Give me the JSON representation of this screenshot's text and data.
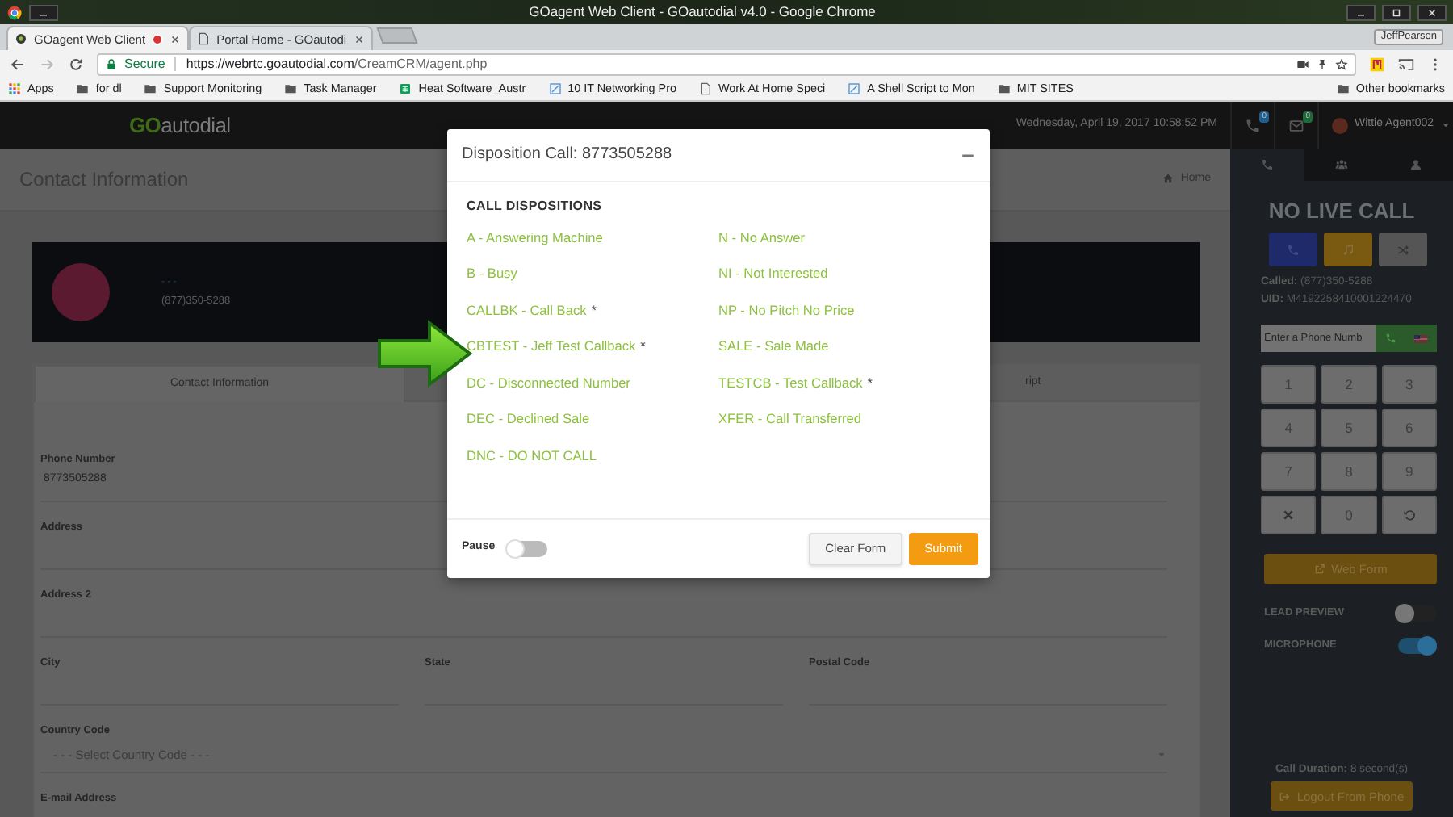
{
  "window": {
    "title": "GOagent Web Client - GOautodial v4.0 - Google Chrome"
  },
  "browser": {
    "tabs": [
      {
        "label": "GOagent Web Client",
        "selected": true,
        "recording": true
      },
      {
        "label": "Portal Home - GOautodi",
        "selected": false,
        "recording": false
      }
    ],
    "profile": "JeffPearson",
    "address": {
      "secure": "Secure",
      "host": "https://webrtc.goautodial.com",
      "path": "/CreamCRM/agent.php"
    },
    "bookmarks": [
      {
        "kind": "apps",
        "label": "Apps"
      },
      {
        "kind": "folder",
        "label": "for dl"
      },
      {
        "kind": "folder",
        "label": "Support Monitoring"
      },
      {
        "kind": "folder",
        "label": "Task Manager"
      },
      {
        "kind": "sheet",
        "label": "Heat Software_Austr"
      },
      {
        "kind": "link",
        "label": "10 IT Networking Pro"
      },
      {
        "kind": "page",
        "label": "Work At Home Speci"
      },
      {
        "kind": "link",
        "label": "A Shell Script to Mon"
      },
      {
        "kind": "folder",
        "label": "MIT SITES"
      }
    ],
    "other_bookmarks": "Other bookmarks"
  },
  "app": {
    "logo": {
      "prefix": "GO",
      "rest": "autodial"
    },
    "datetime": "Wednesday, April 19, 2017 10:58:52 PM",
    "notifications": [
      {
        "kind": "phone",
        "count": "0",
        "color": "#1f5f8f"
      },
      {
        "kind": "mail",
        "count": "0",
        "color": "#1d6b3a"
      }
    ],
    "user": "Wittie Agent002"
  },
  "page": {
    "title": "Contact Information",
    "breadcrumb": "Home",
    "contact": {
      "name": "- - -",
      "phone": "(877)350-5288"
    },
    "tabs": [
      {
        "label": "Contact Information",
        "selected": true
      },
      {
        "label": "ript",
        "selected": false
      }
    ],
    "field_rows": [
      {
        "fields": [
          {
            "kind": "text",
            "label": "Phone Number",
            "value": "8773505288"
          }
        ]
      },
      {
        "fields": [
          {
            "kind": "text",
            "label": "Address"
          }
        ]
      },
      {
        "fields": [
          {
            "kind": "text",
            "label": "Address 2"
          }
        ]
      },
      {
        "fields": [
          {
            "kind": "text",
            "label": "City"
          },
          {
            "kind": "text",
            "label": "State"
          },
          {
            "kind": "text",
            "label": "Postal Code"
          }
        ]
      },
      {
        "fields": [
          {
            "kind": "select",
            "label": "Country Code",
            "value": "- - - Select Country Code - - -"
          }
        ]
      },
      {
        "fields": [
          {
            "kind": "text",
            "label": "E-mail Address"
          }
        ]
      }
    ]
  },
  "sidebar": {
    "tabs": [
      {
        "kind": "phone",
        "selected": true
      },
      {
        "kind": "users",
        "selected": false
      },
      {
        "kind": "user",
        "selected": false
      }
    ],
    "status": "NO LIVE CALL",
    "call_buttons": [
      {
        "kind": "phone"
      },
      {
        "kind": "music"
      },
      {
        "kind": "shuffle"
      }
    ],
    "info": [
      {
        "label": "Called:",
        "value": "(877)350-5288"
      },
      {
        "label": "UID:",
        "value": "M4192258410001224470"
      }
    ],
    "dial": {
      "placeholder": "Enter a Phone Numb"
    },
    "keys": [
      {
        "kind": "digit",
        "label": "1"
      },
      {
        "kind": "digit",
        "label": "2"
      },
      {
        "kind": "digit",
        "label": "3"
      },
      {
        "kind": "digit",
        "label": "4"
      },
      {
        "kind": "digit",
        "label": "5"
      },
      {
        "kind": "digit",
        "label": "6"
      },
      {
        "kind": "digit",
        "label": "7"
      },
      {
        "kind": "digit",
        "label": "8"
      },
      {
        "kind": "digit",
        "label": "9"
      },
      {
        "kind": "clear"
      },
      {
        "kind": "digit",
        "label": "0"
      },
      {
        "kind": "undo"
      }
    ],
    "web_form": "Web Form",
    "toggles": [
      {
        "label": "LEAD PREVIEW",
        "on": false
      },
      {
        "label": "MICROPHONE",
        "on": true
      }
    ],
    "duration": {
      "label": "Call Duration:",
      "value": "8 second(s)"
    },
    "logout": "Logout From Phone"
  },
  "modal": {
    "title": "Disposition Call: 8773505288",
    "heading": "CALL DISPOSITIONS",
    "columns": [
      {
        "items": [
          {
            "label": "A - Answering Machine"
          },
          {
            "label": "B - Busy"
          },
          {
            "label": "CALLBK - Call Back",
            "mark": "*"
          },
          {
            "label": "CBTEST - Jeff Test Callback",
            "mark": "*"
          },
          {
            "label": "DC - Disconnected Number"
          },
          {
            "label": "DEC - Declined Sale"
          },
          {
            "label": "DNC - DO NOT CALL"
          }
        ]
      },
      {
        "items": [
          {
            "label": "N - No Answer"
          },
          {
            "label": "NI - Not Interested"
          },
          {
            "label": "NP - No Pitch No Price"
          },
          {
            "label": "SALE - Sale Made"
          },
          {
            "label": "TESTCB - Test Callback",
            "mark": "*"
          },
          {
            "label": "XFER - Call Transferred"
          }
        ]
      }
    ],
    "pause": {
      "label": "Pause",
      "on": false
    },
    "buttons": [
      {
        "kind": "default",
        "label": "Clear Form"
      },
      {
        "kind": "primary",
        "label": "Submit"
      }
    ]
  }
}
